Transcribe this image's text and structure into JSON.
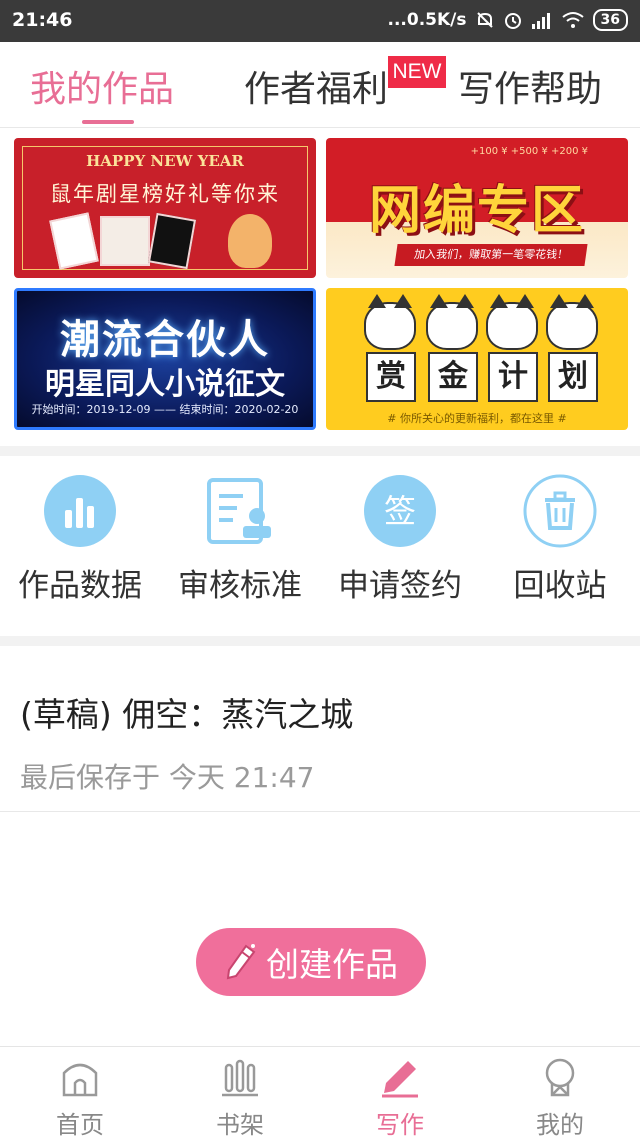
{
  "status_bar": {
    "time": "21:46",
    "network_speed": "...0.5K/s",
    "battery": "36"
  },
  "tabs": [
    {
      "label": "我的作品",
      "active": true
    },
    {
      "label": "作者福利",
      "active": false,
      "badge": "NEW"
    },
    {
      "label": "写作帮助",
      "active": false
    }
  ],
  "banners": {
    "new_year": {
      "heading": "HAPPY NEW YEAR",
      "title": "鼠年剧星榜好礼等你来"
    },
    "editor_zone": {
      "title": "网编专区",
      "strip": "加入我们，赚取第一笔零花钱！",
      "top_note": "+100 ¥  +500 ¥  +200 ¥"
    },
    "partner": {
      "title": "潮流合伙人",
      "subtitle": "明星同人小说征文",
      "dates": "开始时间：2019-12-09 —— 结束时间：2020-02-20"
    },
    "bounty": {
      "chars": [
        "赏",
        "金",
        "计",
        "划"
      ],
      "footer": "# 你所关心的更新福利，都在这里 #"
    }
  },
  "quick_actions": [
    {
      "label": "作品数据",
      "icon": "bar-chart-icon"
    },
    {
      "label": "审核标准",
      "icon": "document-stamp-icon"
    },
    {
      "label": "申请签约",
      "icon": "sign-icon"
    },
    {
      "label": "回收站",
      "icon": "trash-icon"
    }
  ],
  "draft": {
    "title": "(草稿) 佣空：蒸汽之城",
    "meta": "最后保存于 今天 21:47"
  },
  "create_button": {
    "label": "创建作品"
  },
  "bottom_nav": [
    {
      "label": "首页",
      "icon": "home-icon",
      "active": false
    },
    {
      "label": "书架",
      "icon": "bookshelf-icon",
      "active": false
    },
    {
      "label": "写作",
      "icon": "pen-icon",
      "active": true
    },
    {
      "label": "我的",
      "icon": "profile-icon",
      "active": false
    }
  ],
  "colors": {
    "accent": "#e86e95",
    "button": "#f06f9b",
    "icon_blue": "#8fd0f4",
    "badge_red": "#ef2b47"
  }
}
